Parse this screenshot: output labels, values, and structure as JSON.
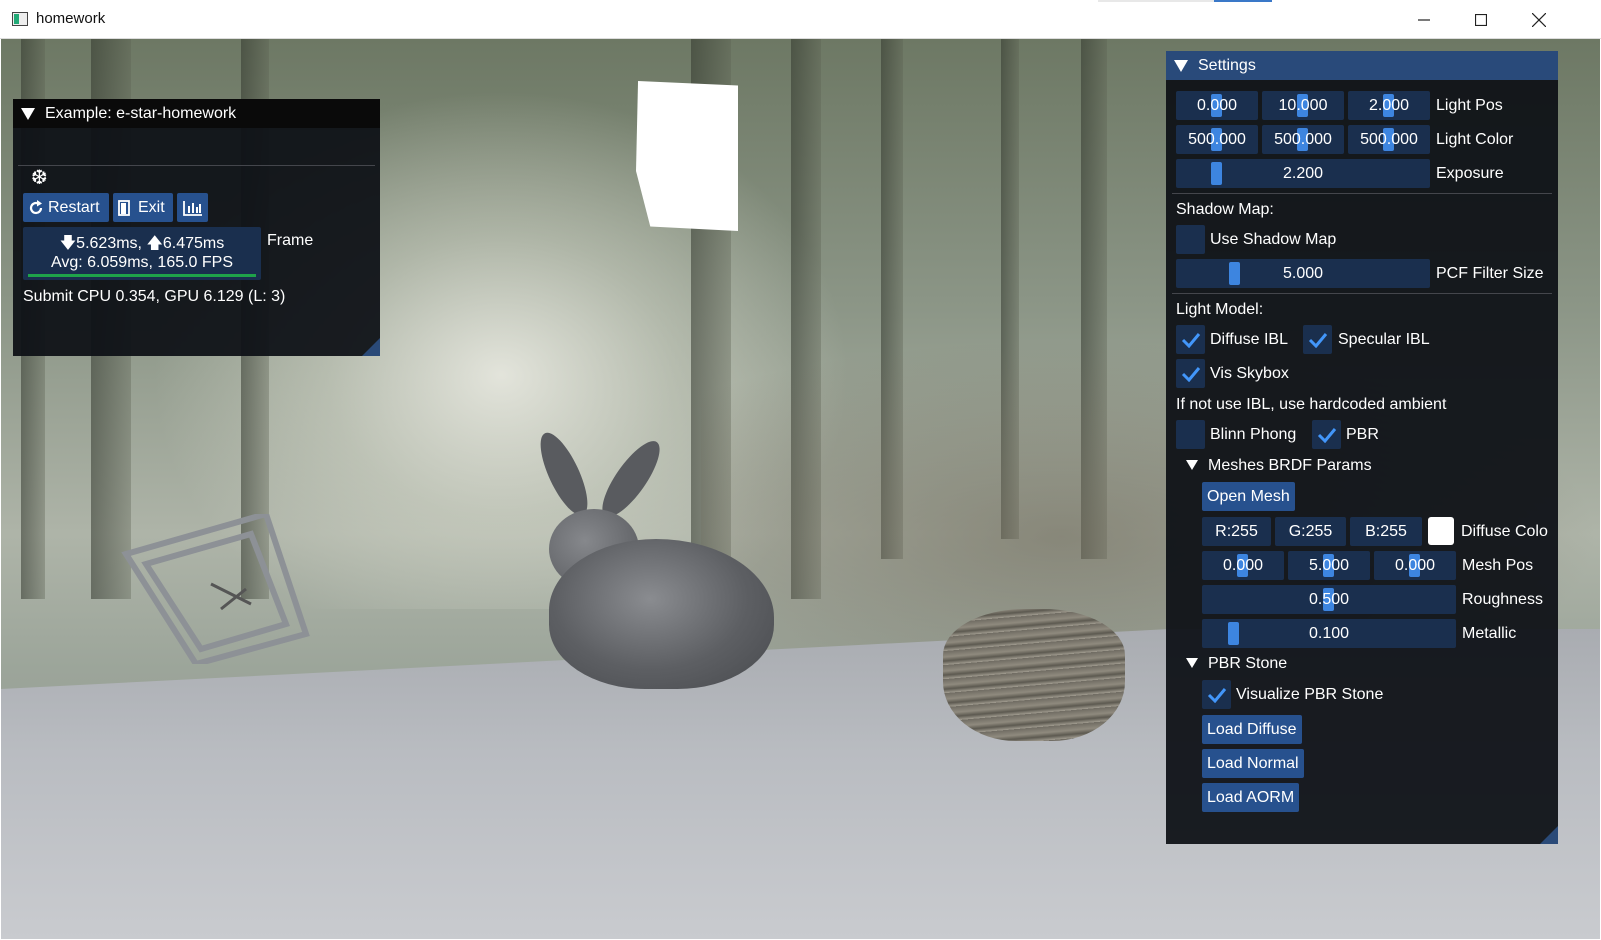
{
  "window": {
    "title": "homework",
    "minimize_icon": "minimize-icon",
    "maximize_icon": "maximize-icon",
    "close_icon": "close-icon"
  },
  "example_window": {
    "title": "Example: e-star-homework",
    "snowflake_icon": "❆",
    "buttons": {
      "restart": "Restart",
      "exit": "Exit",
      "stats_icon": "bar-chart-icon"
    },
    "frame": {
      "down_time": "5.623ms,",
      "up_time": "6.475ms",
      "avg": "Avg: 6.059ms, 165.0 FPS",
      "label": "Frame"
    },
    "submit": "Submit CPU 0.354, GPU 6.129 (L: 3)"
  },
  "settings": {
    "title": "Settings",
    "light_pos": {
      "label": "Light Pos",
      "values": [
        "0.000",
        "10.000",
        "2.000"
      ]
    },
    "light_color": {
      "label": "Light Color",
      "values": [
        "500.000",
        "500.000",
        "500.000"
      ]
    },
    "exposure": {
      "label": "Exposure",
      "value": "2.200"
    },
    "shadow_map": {
      "header": "Shadow Map:",
      "use_shadow_map": {
        "label": "Use Shadow Map",
        "checked": false
      },
      "pcf_filter": {
        "label": "PCF Filter Size",
        "value": "5.000"
      }
    },
    "light_model": {
      "header": "Light Model:",
      "diffuse_ibl": {
        "label": "Diffuse IBL",
        "checked": true
      },
      "specular_ibl": {
        "label": "Specular IBL",
        "checked": true
      },
      "vis_skybox": {
        "label": "Vis Skybox",
        "checked": true
      },
      "note": "If not use IBL, use hardcoded ambient",
      "blinn_phong": {
        "label": "Blinn Phong",
        "checked": false
      },
      "pbr": {
        "label": "PBR",
        "checked": true
      }
    },
    "meshes_brdf": {
      "header": "Meshes BRDF Params",
      "open_mesh": "Open Mesh",
      "diffuse_color": {
        "label": "Diffuse Colo",
        "r": "R:255",
        "g": "G:255",
        "b": "B:255",
        "swatch": "#ffffff"
      },
      "mesh_pos": {
        "label": "Mesh Pos",
        "values": [
          "0.000",
          "5.000",
          "0.000"
        ]
      },
      "roughness": {
        "label": "Roughness",
        "value": "0.500"
      },
      "metallic": {
        "label": "Metallic",
        "value": "0.100"
      }
    },
    "pbr_stone": {
      "header": "PBR Stone",
      "visualize": {
        "label": "Visualize PBR Stone",
        "checked": true
      },
      "load_diffuse": "Load Diffuse",
      "load_normal": "Load Normal",
      "load_aorm": "Load AORM"
    }
  },
  "colors": {
    "imgui_button": "#27518e",
    "imgui_frame": "#1a2f4e",
    "imgui_grab": "#3d85e0",
    "imgui_check": "#4296fa",
    "imgui_title_active": "#294a7a",
    "fps_bar": "#1fa34a"
  }
}
